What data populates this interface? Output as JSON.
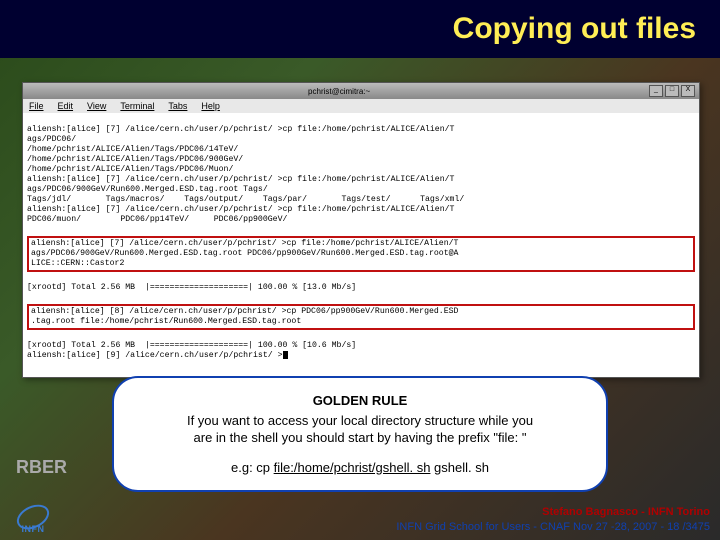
{
  "title": "Copying out files",
  "terminal": {
    "window_title": "pchrist@cimitra:~",
    "menu": [
      "File",
      "Edit",
      "View",
      "Terminal",
      "Tabs",
      "Help"
    ],
    "controls": [
      "_",
      "□",
      "X"
    ],
    "block_top": "aliensh:[alice] [7] /alice/cern.ch/user/p/pchrist/ >cp file:/home/pchrist/ALICE/Alien/T\nags/PDC06/\n/home/pchrist/ALICE/Alien/Tags/PDC06/14TeV/\n/home/pchrist/ALICE/Alien/Tags/PDC06/900GeV/\n/home/pchrist/ALICE/Alien/Tags/PDC06/Muon/\naliensh:[alice] [7] /alice/cern.ch/user/p/pchrist/ >cp file:/home/pchrist/ALICE/Alien/T\nags/PDC06/900GeV/Run600.Merged.ESD.tag.root Tags/\nTags/jdl/       Tags/macros/    Tags/output/    Tags/par/       Tags/test/      Tags/xml/\naliensh:[alice] [7] /alice/cern.ch/user/p/pchrist/ >cp file:/home/pchrist/ALICE/Alien/T\nPDC06/muon/        PDC06/pp14TeV/     PDC06/pp900GeV/",
    "highlight1": "aliensh:[alice] [7] /alice/cern.ch/user/p/pchrist/ >cp file:/home/pchrist/ALICE/Alien/T\nags/PDC06/900GeV/Run600.Merged.ESD.tag.root PDC06/pp900GeV/Run600.Merged.ESD.tag.root@A\nLICE::CERN::Castor2",
    "mid_line": "[xrootd] Total 2.56 MB  |====================| 100.00 % [13.0 Mb/s]",
    "highlight2": "aliensh:[alice] [8] /alice/cern.ch/user/p/pchrist/ >cp PDC06/pp900GeV/Run600.Merged.ESD\n.tag.root file:/home/pchrist/Run600.Merged.ESD.tag.root",
    "block_bottom": "[xrootd] Total 2.56 MB  |====================| 100.00 % [10.6 Mb/s]\naliensh:[alice] [9] /alice/cern.ch/user/p/pchrist/ >"
  },
  "callout": {
    "headline": "GOLDEN RULE",
    "line1": "If you want to access your local directory structure while you",
    "line2": "are in the shell you should start by having the prefix \"file: \"",
    "example_prefix": "e.g: cp ",
    "example_link": "file:/home/pchrist/gshell. sh",
    "example_suffix": " gshell. sh"
  },
  "corner_label": "RBER",
  "footer": {
    "author": "Stefano Bagnasco - INFN Torino",
    "venue": "INFN Grid School for Users - CNAF Nov 27 -28, 2007 - 18 /3475"
  },
  "logo_text": "INFN"
}
